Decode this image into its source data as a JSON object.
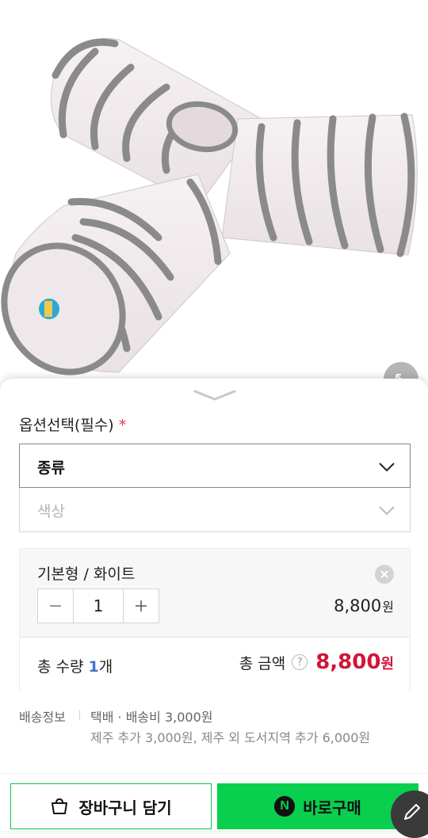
{
  "option": {
    "title": "옵션선택(필수)",
    "required_mark": "*",
    "select1_label": "종류",
    "select2_label": "색상"
  },
  "selected_item": {
    "name": "기본형 / 화이트",
    "quantity": "1",
    "price": "8,800",
    "price_unit": "원"
  },
  "total": {
    "qty_prefix": "총 수량",
    "qty_num": "1",
    "qty_suffix": "개",
    "amount_label": "총 금액",
    "help": "?",
    "price": "8,800",
    "price_unit": "원"
  },
  "shipping": {
    "label": "배송정보",
    "main": "택배 · 배송비 3,000원",
    "extra": "제주 추가 3,000원, 제주 외 도서지역 추가 6,000원"
  },
  "buttons": {
    "cart": "장바구니 담기",
    "buy": "바로구매",
    "buy_logo": "N"
  },
  "colors": {
    "accent_green": "#08cf4e",
    "price_red": "#d1153a",
    "qty_blue": "#3d74d1"
  }
}
